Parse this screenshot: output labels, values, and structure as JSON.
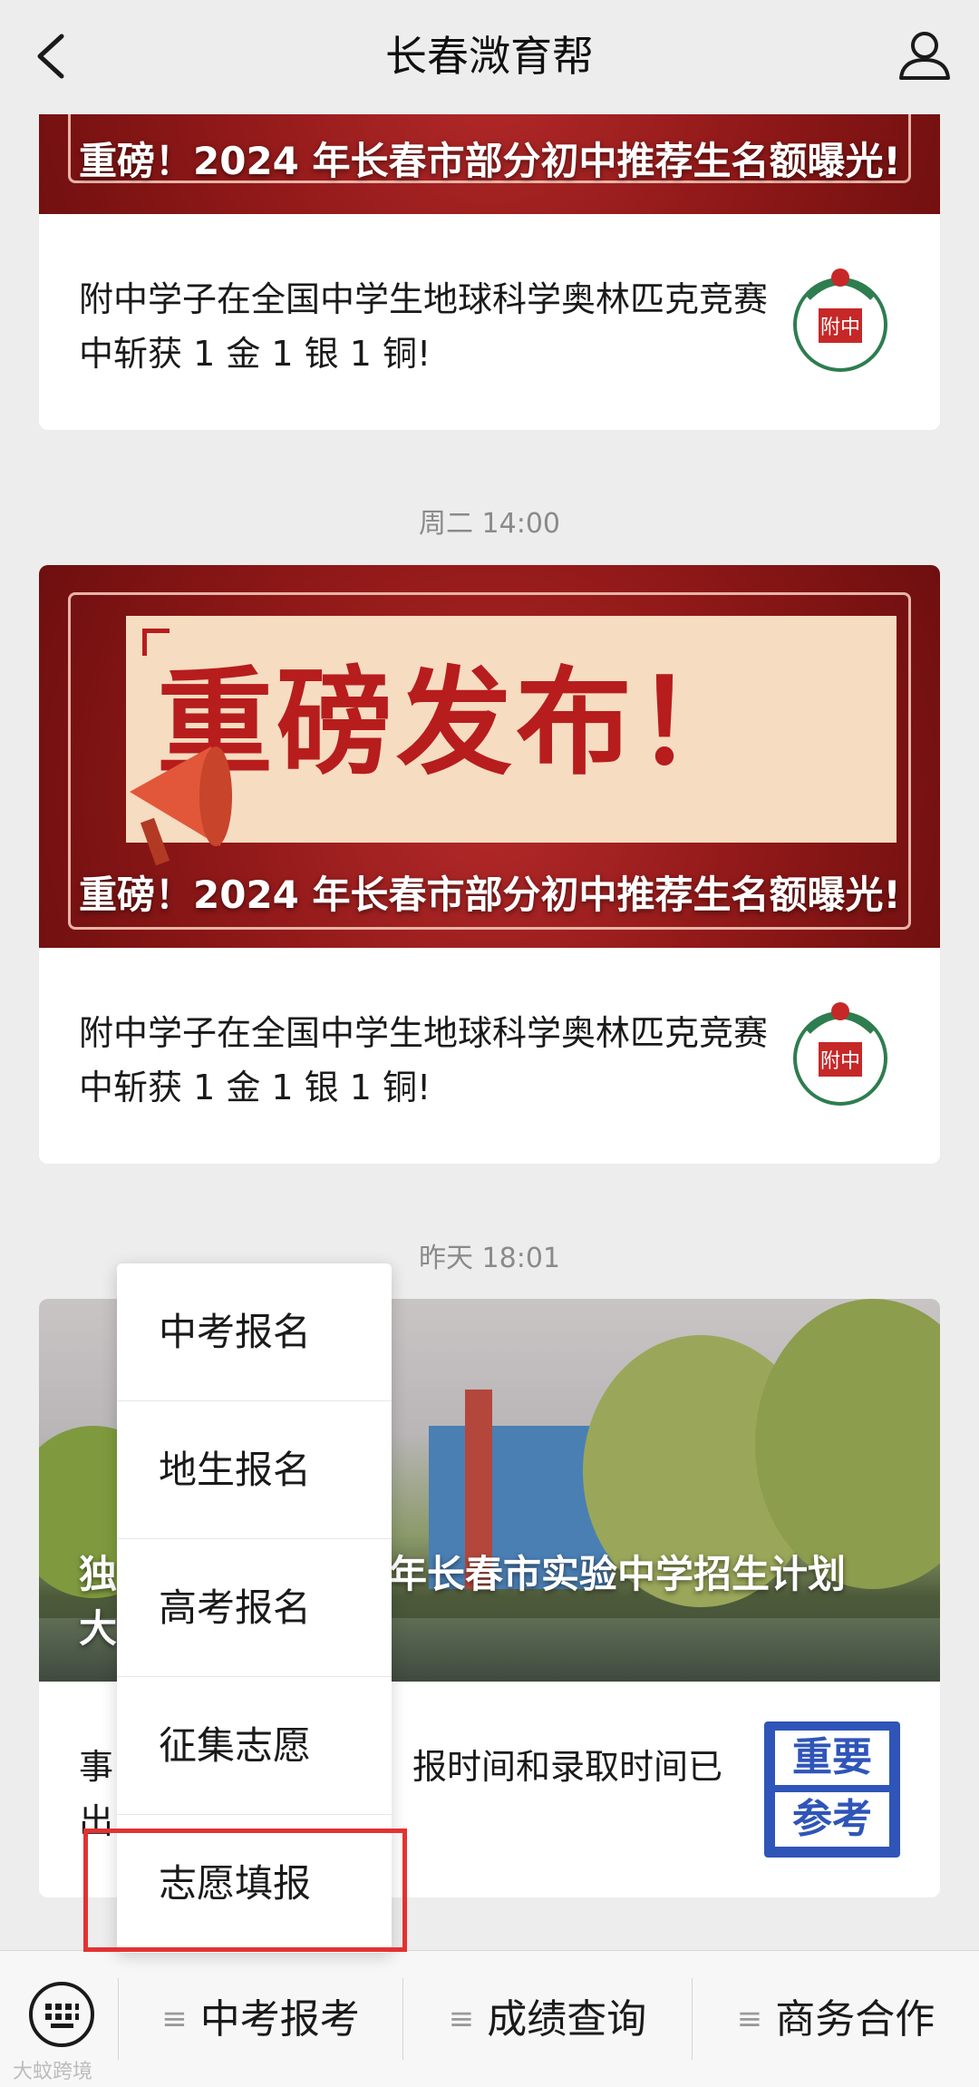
{
  "header": {
    "title": "长春溦育帮"
  },
  "feed": {
    "group1": {
      "cover_title": "重磅！2024 年长春市部分初中推荐生名额曝光!",
      "sub_title": "附中学子在全国中学生地球科学奥林匹克竞赛中斩获 1 金 1 银 1 铜!"
    },
    "timestamp2": "周二 14:00",
    "group2": {
      "banner_text": "重磅发布！",
      "cover_title": "重磅！2024 年长春市部分初中推荐生名额曝光!",
      "sub_title": "附中学子在全国中学生地球科学奥林匹克竞赛中斩获 1 金 1 银 1 铜!"
    },
    "timestamp3": "昨天 18:01",
    "group3": {
      "cover_title_left": "独",
      "cover_title_left2": "大",
      "cover_title": "年长春市实验中学招生计划",
      "sub_title_left": "事",
      "sub_title_left2": "出",
      "sub_title": "报时间和录取时间已",
      "thumb_text_1": "重要",
      "thumb_text_2": "参考"
    }
  },
  "menu": {
    "items": [
      "中考报名",
      "地生报名",
      "高考报名",
      "征集志愿",
      "志愿填报"
    ]
  },
  "bottom_nav": {
    "items": [
      "中考报考",
      "成绩查询",
      "商务合作"
    ]
  },
  "watermark": "大蚊跨境",
  "colors": {
    "highlight": "#e23232",
    "banner_red": "#b71d1d"
  }
}
